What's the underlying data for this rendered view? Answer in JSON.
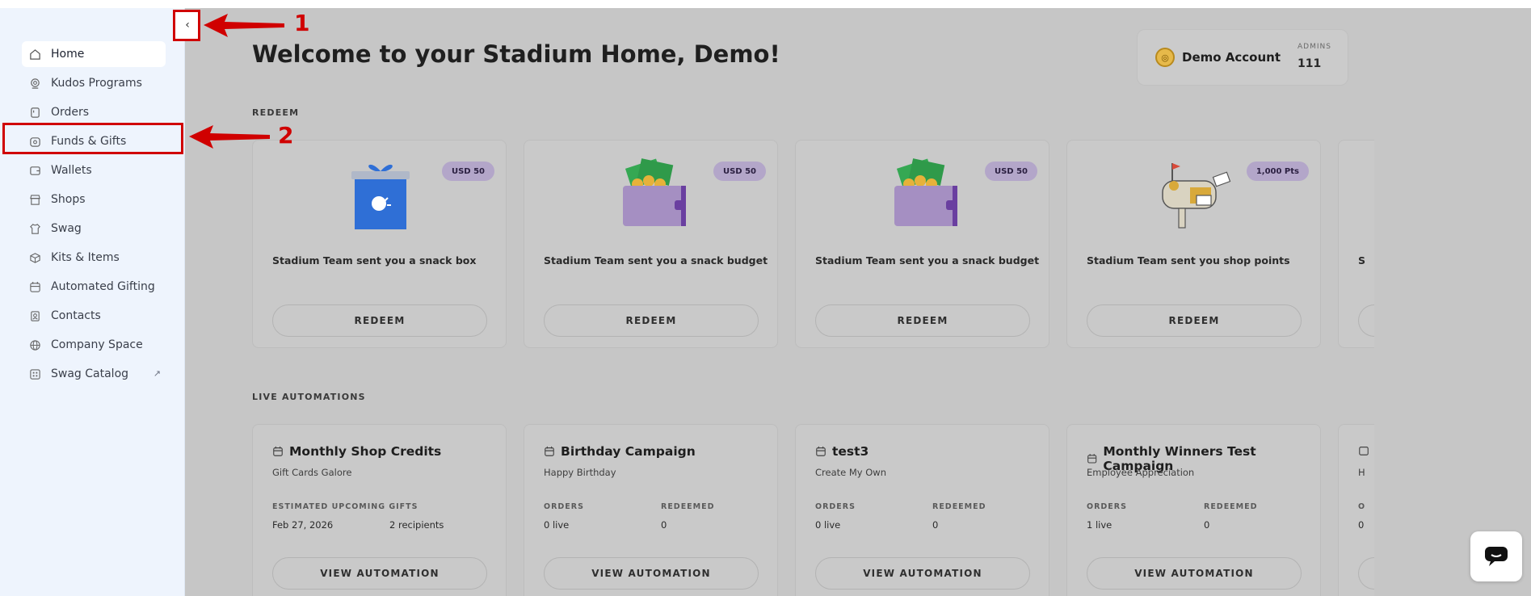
{
  "sidebar": {
    "items": [
      {
        "label": "Home",
        "icon": "home-icon"
      },
      {
        "label": "Kudos Programs",
        "icon": "kudos-icon"
      },
      {
        "label": "Orders",
        "icon": "orders-icon"
      },
      {
        "label": "Funds & Gifts",
        "icon": "funds-gifts-icon"
      },
      {
        "label": "Wallets",
        "icon": "wallet-icon"
      },
      {
        "label": "Shops",
        "icon": "shop-icon"
      },
      {
        "label": "Swag",
        "icon": "shirt-icon"
      },
      {
        "label": "Kits & Items",
        "icon": "box-icon"
      },
      {
        "label": "Automated Gifting",
        "icon": "calendar-icon"
      },
      {
        "label": "Contacts",
        "icon": "contacts-icon"
      },
      {
        "label": "Company Space",
        "icon": "globe-icon"
      },
      {
        "label": "Swag Catalog",
        "icon": "catalog-icon",
        "external": "↗"
      }
    ],
    "collapse_label": "‹"
  },
  "header": {
    "title": "Welcome to your Stadium Home, Demo!",
    "account_name": "Demo Account",
    "admins_label": "ADMINS",
    "admins_count": "111"
  },
  "redeem": {
    "section_label": "REDEEM",
    "cards": [
      {
        "badge": "USD 50",
        "text": "Stadium Team sent you a snack box",
        "button": "REDEEM",
        "art": "gift-box"
      },
      {
        "badge": "USD 50",
        "text": "Stadium Team sent you a snack budget",
        "button": "REDEEM",
        "art": "wallet-cash"
      },
      {
        "badge": "USD 50",
        "text": "Stadium Team sent you a snack budget",
        "button": "REDEEM",
        "art": "wallet-cash"
      },
      {
        "badge": "1,000 Pts",
        "text": "Stadium Team sent you shop points",
        "button": "REDEEM",
        "art": "mailbox"
      },
      {
        "partial_text": "S"
      }
    ]
  },
  "automations": {
    "section_label": "LIVE AUTOMATIONS",
    "cards": [
      {
        "title": "Monthly Shop Credits",
        "subtitle": "Gift Cards Galore",
        "stat1_label": "ESTIMATED UPCOMING GIFTS",
        "stat1_value": "Feb 27, 2026",
        "stat2_label": "",
        "stat2_value": "2 recipients",
        "button": "VIEW AUTOMATION"
      },
      {
        "title": "Birthday Campaign",
        "subtitle": "Happy Birthday",
        "stat1_label": "ORDERS",
        "stat1_value": "0 live",
        "stat2_label": "REDEEMED",
        "stat2_value": "0",
        "button": "VIEW AUTOMATION"
      },
      {
        "title": "test3",
        "subtitle": "Create My Own",
        "stat1_label": "ORDERS",
        "stat1_value": "0 live",
        "stat2_label": "REDEEMED",
        "stat2_value": "0",
        "button": "VIEW AUTOMATION"
      },
      {
        "title": "Monthly Winners Test Campaign",
        "subtitle": "Employee Appreciation",
        "stat1_label": "ORDERS",
        "stat1_value": "1 live",
        "stat2_label": "REDEEMED",
        "stat2_value": "0",
        "button": "VIEW AUTOMATION"
      },
      {
        "partial_subtitle": "H",
        "partial_label": "O",
        "partial_value": "0"
      }
    ]
  },
  "annotations": {
    "one": "1",
    "two": "2"
  },
  "colors": {
    "sidebar_bg": "#eef4fd",
    "overlay_bg": "#c6c6c6",
    "annotation_red": "#d00000",
    "badge_purple": "#b3a6c9"
  }
}
